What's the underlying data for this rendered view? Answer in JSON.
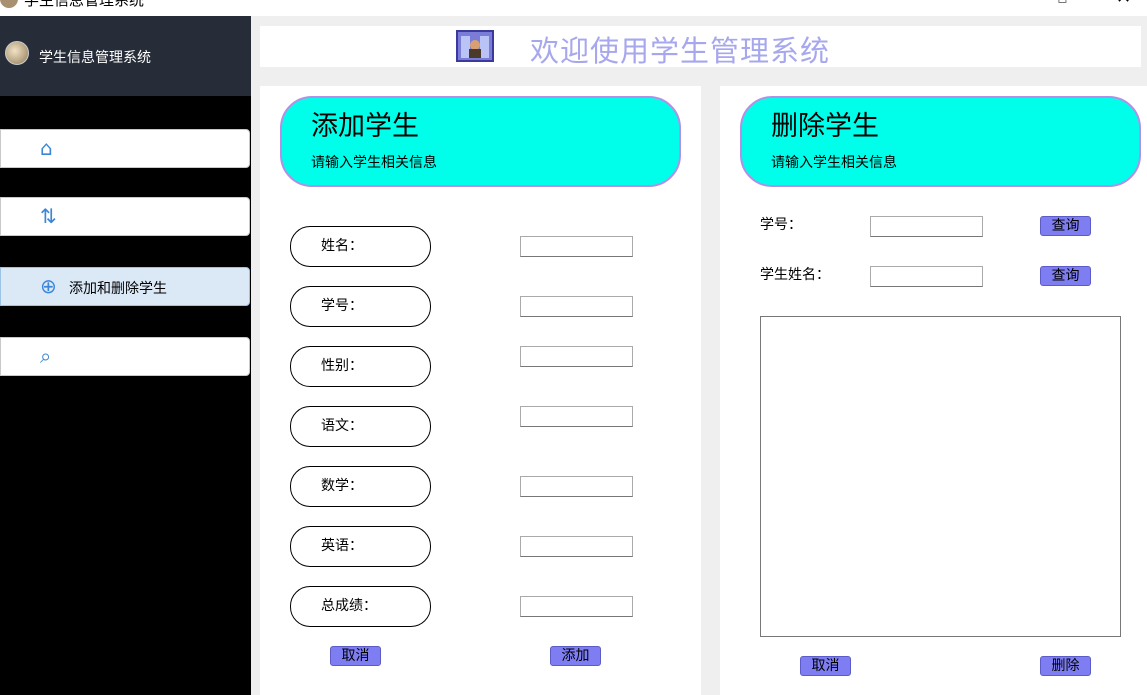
{
  "window": {
    "title": "学生信息管理系统",
    "minimize_glyph": "▫",
    "close_glyph": "✕"
  },
  "sidebar": {
    "title": "学生信息管理系统",
    "items": [
      {
        "icon": "home-icon",
        "glyph": "⌂",
        "label": ""
      },
      {
        "icon": "sort-arrows-icon",
        "glyph": "⇅",
        "label": ""
      },
      {
        "icon": "add-circle-icon",
        "glyph": "⊕",
        "label": "添加和删除学生"
      },
      {
        "icon": "search-icon",
        "glyph": "⌕",
        "label": ""
      }
    ]
  },
  "header": {
    "banner_text": "欢迎使用学生管理系统"
  },
  "add_panel": {
    "title": "添加学生",
    "subtitle": "请输入学生相关信息",
    "fields": [
      {
        "label": "姓名：",
        "value": ""
      },
      {
        "label": "学号：",
        "value": ""
      },
      {
        "label": "性别：",
        "value": ""
      },
      {
        "label": "语文：",
        "value": ""
      },
      {
        "label": "数学：",
        "value": ""
      },
      {
        "label": "英语：",
        "value": ""
      },
      {
        "label": "总成绩：",
        "value": ""
      }
    ],
    "cancel_label": "取消",
    "add_label": "添加"
  },
  "delete_panel": {
    "title": "删除学生",
    "subtitle": "请输入学生相关信息",
    "id_label": "学号：",
    "id_value": "",
    "name_label": "学生姓名：",
    "name_value": "",
    "query_label": "查询",
    "cancel_label": "取消",
    "delete_label": "删除"
  },
  "colors": {
    "accent_cyan": "#00ffea",
    "button_blue": "#7e7ef2",
    "sidebar_bg": "#000000",
    "banner_text": "#a7a7ee"
  }
}
